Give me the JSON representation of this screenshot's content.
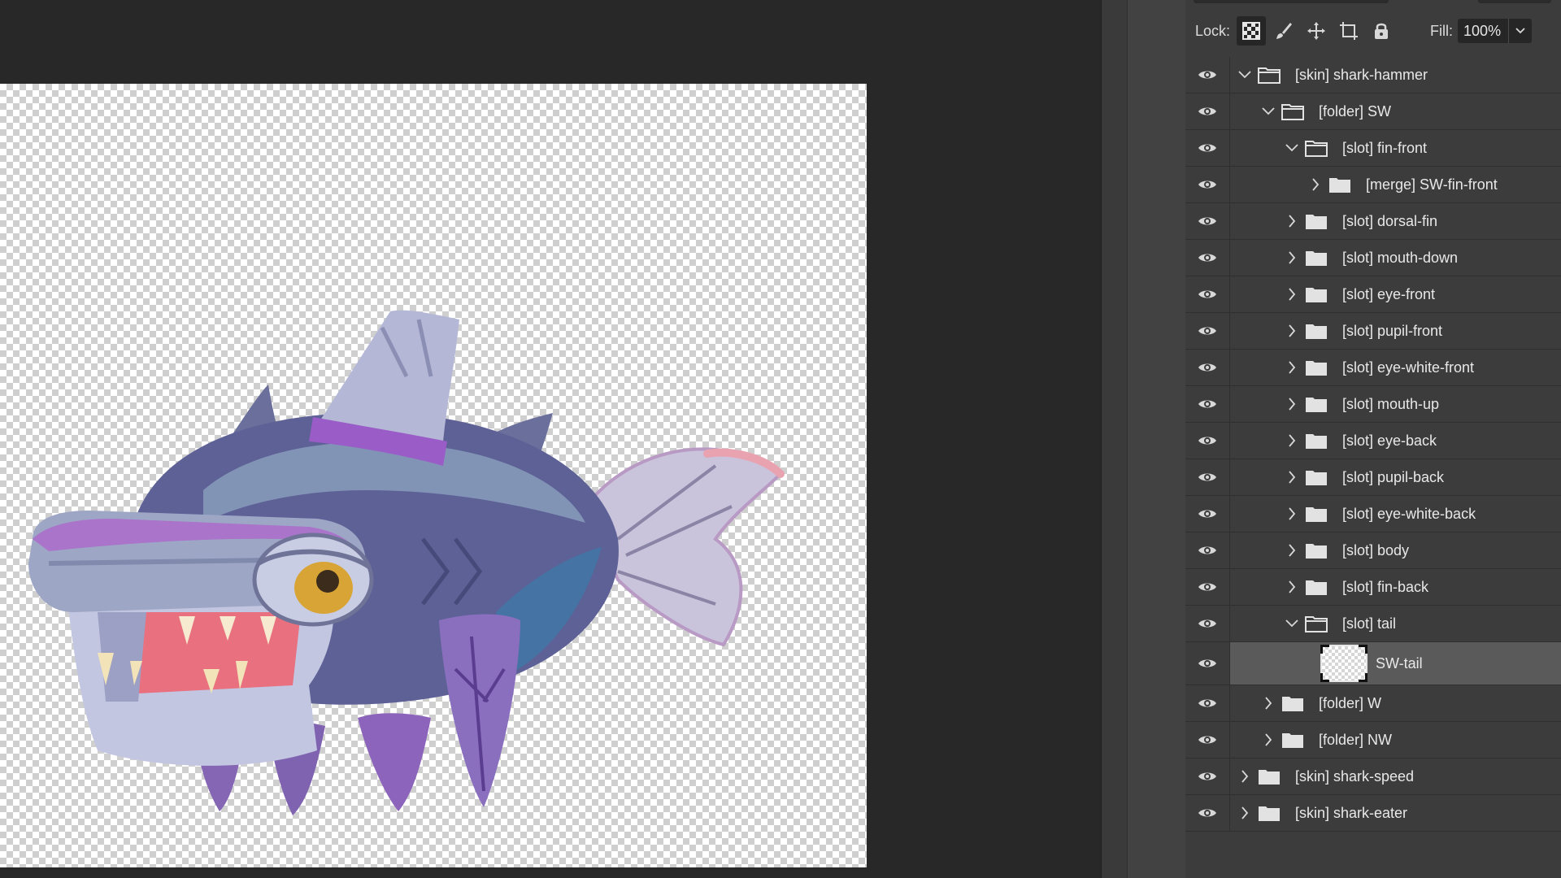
{
  "lock_bar": {
    "lock_label": "Lock:",
    "fill_label": "Fill:",
    "fill_value": "100%",
    "lock_icons": [
      "checkerboard-lock-icon",
      "brush-lock-icon",
      "move-lock-icon",
      "artboard-lock-icon",
      "padlock-icon"
    ]
  },
  "layers": [
    {
      "name": "[skin] shark-hammer",
      "depth": 0,
      "expanded": true,
      "type": "folder"
    },
    {
      "name": "[folder] SW",
      "depth": 1,
      "expanded": true,
      "type": "folder"
    },
    {
      "name": "[slot] fin-front",
      "depth": 2,
      "expanded": true,
      "type": "folder"
    },
    {
      "name": "[merge] SW-fin-front",
      "depth": 3,
      "expanded": false,
      "type": "folder"
    },
    {
      "name": "[slot] dorsal-fin",
      "depth": 2,
      "expanded": false,
      "type": "folder"
    },
    {
      "name": "[slot] mouth-down",
      "depth": 2,
      "expanded": false,
      "type": "folder"
    },
    {
      "name": "[slot] eye-front",
      "depth": 2,
      "expanded": false,
      "type": "folder"
    },
    {
      "name": "[slot] pupil-front",
      "depth": 2,
      "expanded": false,
      "type": "folder"
    },
    {
      "name": "[slot] eye-white-front",
      "depth": 2,
      "expanded": false,
      "type": "folder"
    },
    {
      "name": "[slot] mouth-up",
      "depth": 2,
      "expanded": false,
      "type": "folder"
    },
    {
      "name": "[slot] eye-back",
      "depth": 2,
      "expanded": false,
      "type": "folder"
    },
    {
      "name": "[slot] pupil-back",
      "depth": 2,
      "expanded": false,
      "type": "folder"
    },
    {
      "name": "[slot] eye-white-back",
      "depth": 2,
      "expanded": false,
      "type": "folder"
    },
    {
      "name": "[slot] body",
      "depth": 2,
      "expanded": false,
      "type": "folder"
    },
    {
      "name": "[slot] fin-back",
      "depth": 2,
      "expanded": false,
      "type": "folder"
    },
    {
      "name": "[slot] tail",
      "depth": 2,
      "expanded": true,
      "type": "folder"
    },
    {
      "name": "SW-tail",
      "depth": 3,
      "expanded": false,
      "type": "layer",
      "selected": true
    },
    {
      "name": "[folder] W",
      "depth": 1,
      "expanded": false,
      "type": "folder"
    },
    {
      "name": "[folder] NW",
      "depth": 1,
      "expanded": false,
      "type": "folder"
    },
    {
      "name": "[skin] shark-speed",
      "depth": 0,
      "expanded": false,
      "type": "folder"
    },
    {
      "name": "[skin] shark-eater",
      "depth": 0,
      "expanded": false,
      "type": "folder"
    }
  ],
  "colors": {
    "panel_bg": "#3c3c3c",
    "selected_row": "#5a5a5a",
    "canvas_bg": "#282828"
  }
}
